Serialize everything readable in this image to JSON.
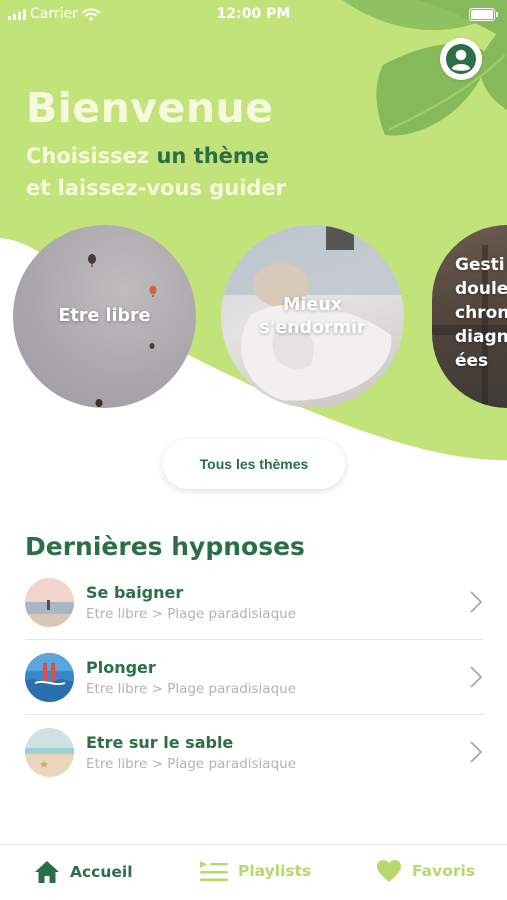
{
  "status_bar": {
    "carrier": "Carrier",
    "time": "12:00 PM"
  },
  "header": {
    "title": "Bienvenue",
    "subtitle_part1": "Choisissez ",
    "subtitle_accent": "un thème",
    "subtitle_line2": "et laissez-vous guider"
  },
  "themes": [
    {
      "label": "Etre libre"
    },
    {
      "label": "Mieux\ns'endormir"
    },
    {
      "label": "Gesti\ndoule\nchron\ndiagn\nées"
    }
  ],
  "all_themes_button": "Tous les thèmes",
  "recent": {
    "title": "Dernières hypnoses",
    "items": [
      {
        "name": "Se baigner",
        "path": "Etre libre > Plage paradisiaque"
      },
      {
        "name": "Plonger",
        "path": "Etre libre > Plage paradisiaque"
      },
      {
        "name": "Etre sur le sable",
        "path": "Etre libre > Plage paradisiaque"
      }
    ]
  },
  "tabbar": {
    "home": "Accueil",
    "playlists": "Playlists",
    "favorites": "Favoris"
  },
  "colors": {
    "lime": "#c2e27a",
    "dark_green": "#2c6e46",
    "light_text": "#f4fbdc",
    "leaf": "#8cbf5f"
  },
  "icons": {
    "avatar": "user-icon",
    "home": "home-icon",
    "playlists": "playlist-icon",
    "favorites": "heart-icon",
    "chevron": "chevron-right-icon"
  }
}
